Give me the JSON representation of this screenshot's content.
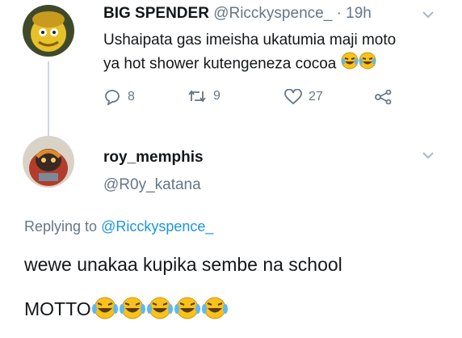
{
  "tweet": {
    "author_name": "BIG SPENDER",
    "author_handle": "@Ricckyspence_",
    "timestamp": "· 19h",
    "text_line1": "Ushaipata gas imeisha ukatumia maji moto",
    "text_line2": "ya hot shower kutengeneza cocoa",
    "reply_count": "8",
    "retweet_count": "9",
    "like_count": "27"
  },
  "reply": {
    "author_name": "roy_memphis",
    "author_handle": "@R0y_katana",
    "replying_prefix": "Replying to",
    "replying_handle": "@Ricckyspence_",
    "text_line1": "wewe unakaa kupika sembe na school",
    "text_line2": "MOTTO"
  },
  "colors": {
    "link": "#1b95e0",
    "muted": "#657786",
    "text": "#14171a"
  }
}
